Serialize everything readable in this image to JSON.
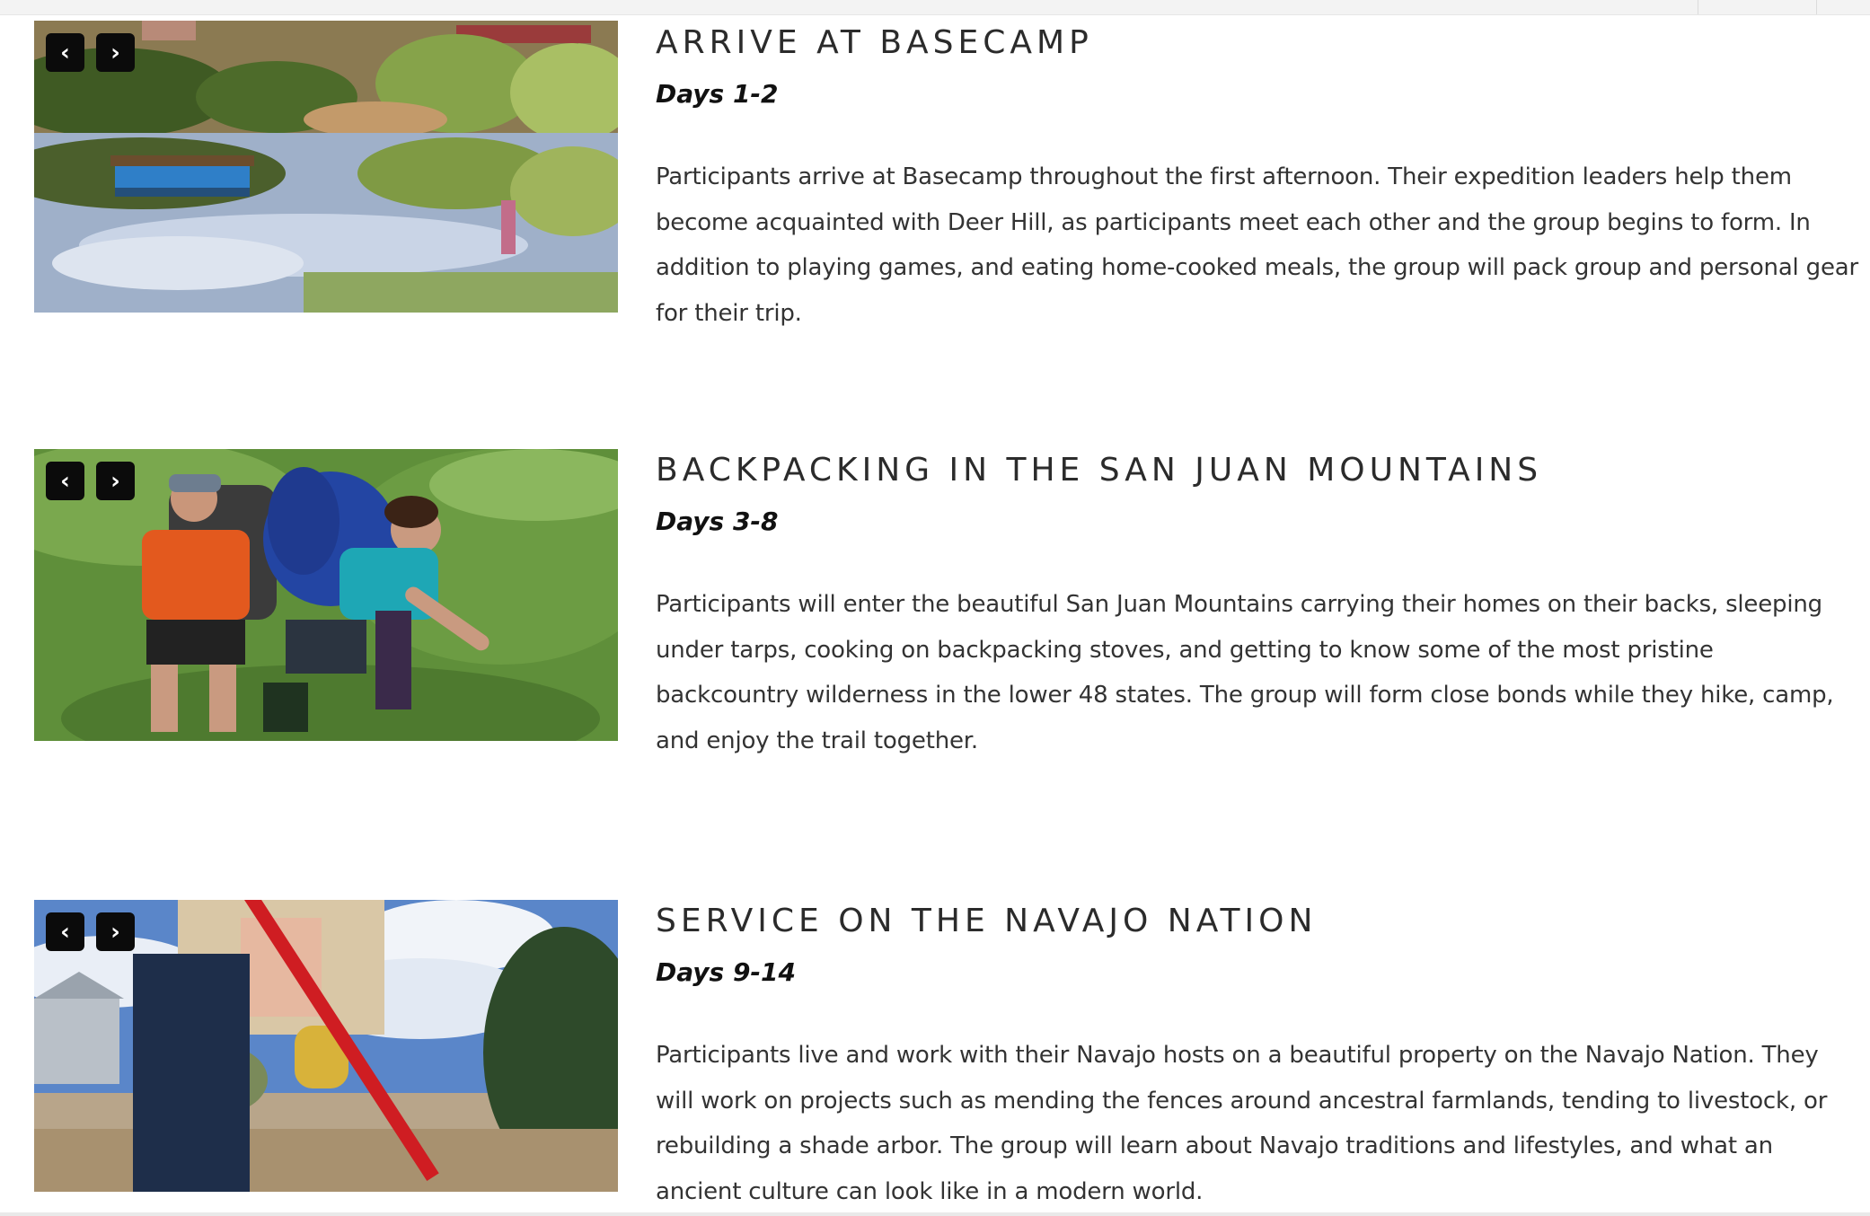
{
  "sections": [
    {
      "title": "ARRIVE AT BASECAMP",
      "days": "Days 1-2",
      "body": "Participants arrive at Basecamp throughout the first afternoon. Their expedition leaders help them become acquainted with Deer Hill, as participants meet each other and the group begins to form. In addition to playing games, and eating home-cooked meals, the group will pack group and personal gear for their trip.",
      "prev_label": "‹",
      "next_label": "›"
    },
    {
      "title": "BACKPACKING IN THE SAN JUAN MOUNTAINS",
      "days": "Days 3-8",
      "body": "Participants will enter the beautiful San Juan Mountains carrying their homes on their backs, sleeping under tarps, cooking on backpacking stoves, and getting to know some of the most pristine backcountry wilderness in the lower 48 states. The group will form close bonds while they hike, camp, and enjoy the trail together.",
      "prev_label": "‹",
      "next_label": "›"
    },
    {
      "title": "SERVICE ON THE NAVAJO NATION",
      "days": "Days 9-14",
      "body": "Participants live and work with their Navajo hosts on a beautiful property on the Navajo Nation.   They will work on projects such as mending the fences around ancestral farmlands, tending to livestock, or rebuilding a shade arbor. The group will learn about Navajo traditions and lifestyles, and what an ancient culture can look like in a modern world.",
      "prev_label": "‹",
      "next_label": "›"
    }
  ],
  "colors": {
    "nav_button_bg": "#0b0b0b",
    "title_text": "#2b2b2b",
    "body_text": "#333333"
  },
  "icons": {
    "prev": "chevron-left-icon",
    "next": "chevron-right-icon"
  }
}
